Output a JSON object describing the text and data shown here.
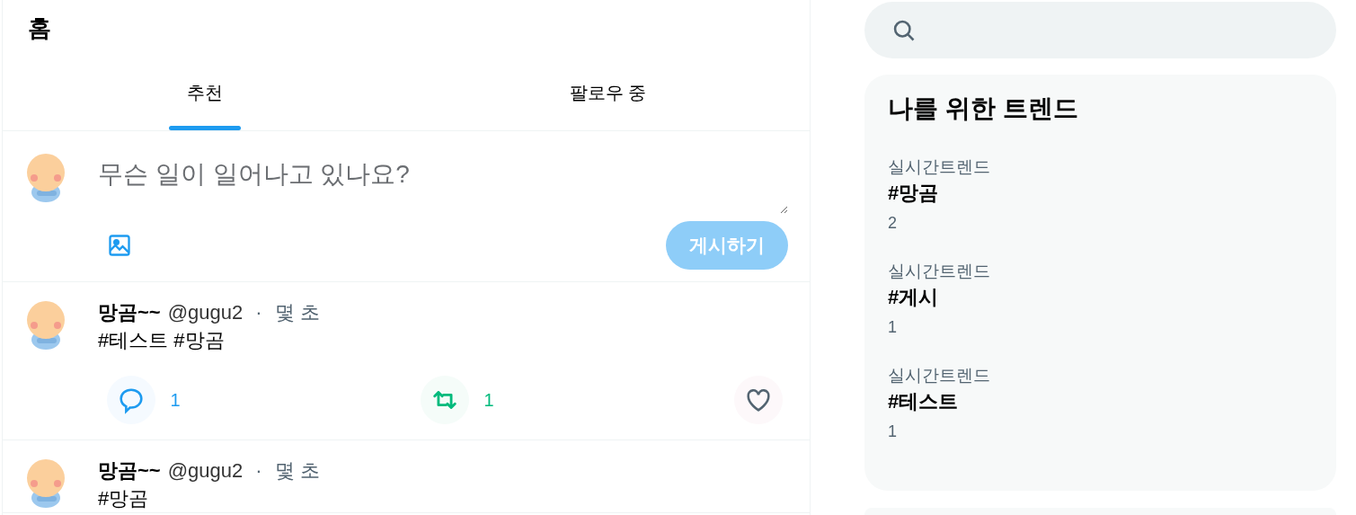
{
  "header": {
    "title": "홈"
  },
  "tabs": [
    {
      "label": "추천",
      "selected": true
    },
    {
      "label": "팔로우 중",
      "selected": false
    }
  ],
  "composer": {
    "placeholder": "무슨 일이 일어나고 있나요?",
    "submit": {
      "label": "게시하기",
      "disabled": true
    }
  },
  "posts": [
    {
      "name": "망곰~~",
      "handle": "@gugu2",
      "separator": "·",
      "time": "몇 초",
      "text": "#테스트 #망곰",
      "actions": [
        {
          "kind": "comment",
          "count": "1",
          "active": true
        },
        {
          "kind": "retweet",
          "count": "1",
          "active": true
        },
        {
          "kind": "like",
          "active": false
        }
      ]
    },
    {
      "name": "망곰~~",
      "handle": "@gugu2",
      "separator": "·",
      "time": "몇 초",
      "text": "#망곰"
    }
  ],
  "trends": {
    "title": "나를 위한 트렌드",
    "items": [
      {
        "category": "실시간트렌드",
        "tag": "#망곰",
        "count": "2"
      },
      {
        "category": "실시간트렌드",
        "tag": "#게시",
        "count": "1"
      },
      {
        "category": "실시간트렌드",
        "tag": "#테스트",
        "count": "1"
      }
    ]
  }
}
